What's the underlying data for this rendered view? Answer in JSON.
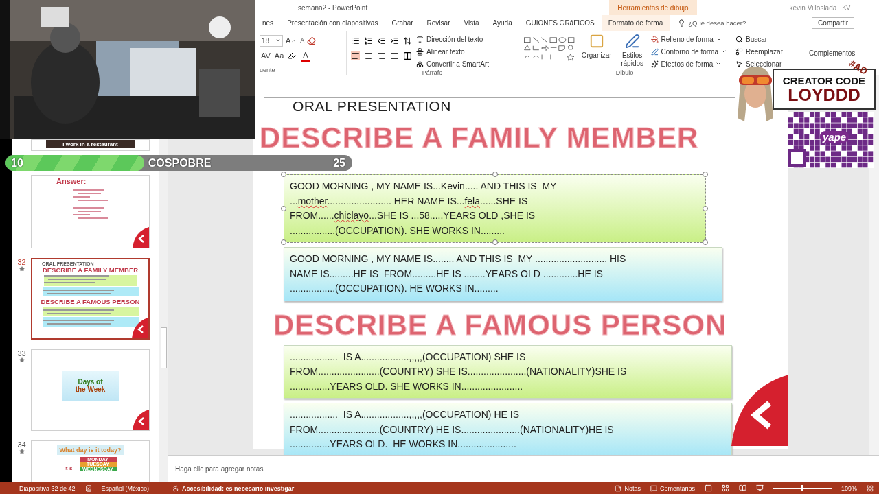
{
  "title_bar": {
    "document_title": "semana2  -  PowerPoint",
    "context_label": "Herramientas de dibujo",
    "user": "kevin Villoslada",
    "user_initials": "KV"
  },
  "tabs": [
    {
      "label": "nes",
      "selected": false,
      "kind": "normal"
    },
    {
      "label": "Presentación con diapositivas",
      "selected": false,
      "kind": "normal"
    },
    {
      "label": "Grabar",
      "selected": false,
      "kind": "normal"
    },
    {
      "label": "Revisar",
      "selected": false,
      "kind": "normal"
    },
    {
      "label": "Vista",
      "selected": false,
      "kind": "normal"
    },
    {
      "label": "Ayuda",
      "selected": false,
      "kind": "normal"
    },
    {
      "label": "GUIONES GRáFICOS",
      "selected": false,
      "kind": "normal"
    },
    {
      "label": "Formato de forma",
      "selected": false,
      "kind": "context"
    }
  ],
  "tell_me": {
    "placeholder": "¿Qué desea hacer?"
  },
  "share": "Compartir",
  "font_group": {
    "label": "uente",
    "font_size": "18",
    "grow": "A",
    "shrink": "A",
    "spacing": "AV",
    "case": "Aa",
    "font_color_letter": "A"
  },
  "paragraph_group": {
    "label": "Párrafo",
    "commands": [
      "Dirección del texto",
      "Alinear texto",
      "Convertir a SmartArt"
    ]
  },
  "drawing_group": {
    "label": "Dibujo",
    "large_buttons": [
      "Organizar",
      "Estilos rápidos"
    ],
    "commands": [
      "Relleno de forma",
      "Contorno de forma",
      "Efectos de forma"
    ]
  },
  "editing_group": {
    "commands": [
      "Buscar",
      "Reemplazar",
      "Seleccionar"
    ]
  },
  "addins": "Complementos",
  "thumbnails": [
    {
      "caption": "I work in a restaurant",
      "selected": false
    },
    {
      "kind": "answers",
      "title": "Answer:",
      "selected": false
    },
    {
      "kind": "family",
      "number": "32",
      "selected": true,
      "texts": [
        "ORAL PRESENTATION",
        "DESCRIBE A FAMILY MEMBER",
        "DESCRIBE A FAMOUS PERSON"
      ]
    },
    {
      "kind": "days",
      "number": "33",
      "selected": false,
      "texts": [
        "Days of",
        "the Week"
      ]
    },
    {
      "kind": "today",
      "number": "34",
      "selected": false,
      "texts": [
        "What day is it today?",
        "MONDAY",
        "TUESDAY",
        "WEDNESDAY",
        "It´s"
      ]
    }
  ],
  "slide": {
    "section_title": "ORAL PRESENTATION",
    "blocks": [
      {
        "kind": "heading",
        "text": "DESCRIBE A FAMILY MEMBER"
      },
      {
        "kind": "textbox",
        "color": "#c9ef86",
        "selected": true,
        "segments": [
          {
            "text": "GOOD MORNING , MY NAME IS...Kevin..... AND THIS IS  MY\n...",
            "misspelled": false
          },
          {
            "text": "mother",
            "misspelled": true
          },
          {
            "text": "........................ HER NAME IS...",
            "misspelled": false
          },
          {
            "text": "fela",
            "misspelled": true
          },
          {
            "text": "......SHE IS\nFROM......",
            "misspelled": false
          },
          {
            "text": "chiclayo",
            "misspelled": true
          },
          {
            "text": "...SHE IS ...58.....YEARS OLD ,SHE IS\n.................(OCCUPATION). SHE WORKS IN.........",
            "misspelled": false
          }
        ]
      },
      {
        "kind": "textbox",
        "color": "#a6e6f7",
        "selected": false,
        "segments": [
          {
            "text": "GOOD MORNING , MY NAME IS........ AND THIS IS  MY ........................... HIS\nNAME IS.........HE IS  FROM.........HE IS ........YEARS OLD .............HE IS\n.................(OCCUPATION). HE WORKS IN.........",
            "misspelled": false
          }
        ]
      },
      {
        "kind": "heading",
        "text": "DESCRIBE A FAMOUS PERSON"
      },
      {
        "kind": "textbox",
        "color": "#c9ef86",
        "selected": false,
        "segments": [
          {
            "text": "..................  IS A..................,,,,,(OCCUPATION) SHE IS\nFROM.......................(COUNTRY) SHE IS......................(NATIONALITY)SHE IS\n...............YEARS OLD. SHE WORKS IN.......................",
            "misspelled": false
          }
        ]
      },
      {
        "kind": "textbox",
        "color": "#a6e6f7",
        "selected": false,
        "segments": [
          {
            "text": "..................  IS A..................,,,,,(OCCUPATION) HE IS\nFROM.......................(COUNTRY) HE IS......................(NATIONALITY)HE IS\n...............YEARS OLD.  HE WORKS IN......................",
            "misspelled": false
          }
        ]
      }
    ]
  },
  "notes": {
    "placeholder": "Haga clic para agregar notas"
  },
  "status_bar": {
    "slide": "Diapositiva 32 de 42",
    "language": "Español (México)",
    "accessibility": "Accesibilidad: es necesario investigar",
    "notes": "Notas",
    "comments": "Comentarios",
    "zoom": {
      "level": 0.47,
      "reading": "109%"
    }
  },
  "stream_goal": {
    "current": "10",
    "label": "COSPOBRE",
    "target": "25",
    "level": 0.4
  },
  "creator_code": {
    "badge": "#AD",
    "title": "CREATOR CODE",
    "code": "LOYDDD"
  },
  "qr": {
    "logo": "yape"
  }
}
